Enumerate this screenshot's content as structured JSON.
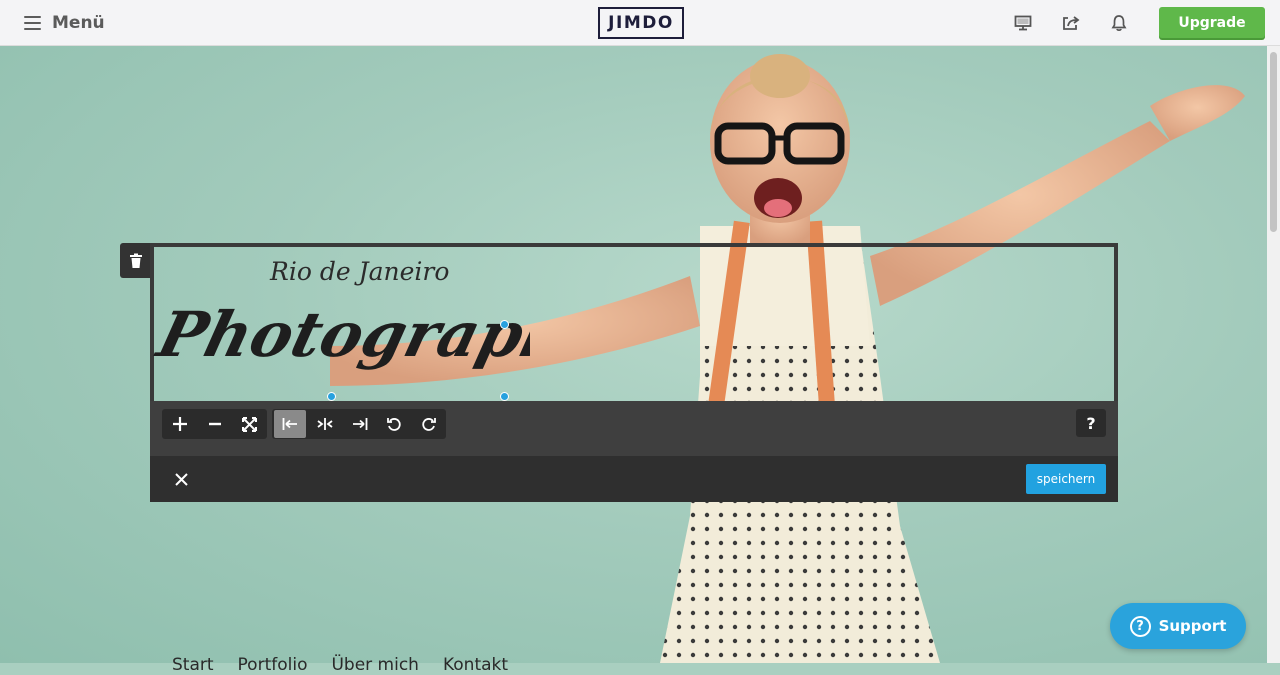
{
  "topbar": {
    "menu_label": "Menü",
    "logo_text": "JIMDO",
    "upgrade_label": "Upgrade",
    "icons": [
      "desktop-preview-icon",
      "share-icon",
      "bell-icon"
    ]
  },
  "editor": {
    "logo_line1": "Rio de Janeiro",
    "logo_line2": "Photography",
    "tools": [
      "plus-icon",
      "minus-icon",
      "fit-icon",
      "align-left-icon",
      "align-center-icon",
      "align-right-icon",
      "rotate-left-icon",
      "rotate-right-icon"
    ],
    "active_tool": "align-left-icon",
    "help_label": "?",
    "save_label": "speichern"
  },
  "nav": {
    "items": [
      "Start",
      "Portfolio",
      "Über mich",
      "Kontakt"
    ]
  },
  "support": {
    "label": "Support"
  },
  "colors": {
    "accent_green": "#5fb84a",
    "accent_blue": "#22a2e0",
    "toolbar_dark": "#3f3f3f"
  }
}
